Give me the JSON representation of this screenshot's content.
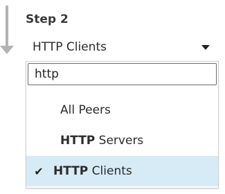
{
  "step": {
    "title": "Step 2"
  },
  "select": {
    "value": "HTTP Clients"
  },
  "search": {
    "value": "http"
  },
  "options": [
    {
      "match": "",
      "rest": "All Peers",
      "selected": false
    },
    {
      "match": "HTTP",
      "rest": " Servers",
      "selected": false
    },
    {
      "match": "HTTP",
      "rest": " Clients",
      "selected": true
    }
  ],
  "check_glyph": "✔",
  "colors": {
    "selected_bg": "#d6ebf6",
    "arrow": "#b3b3b3"
  }
}
